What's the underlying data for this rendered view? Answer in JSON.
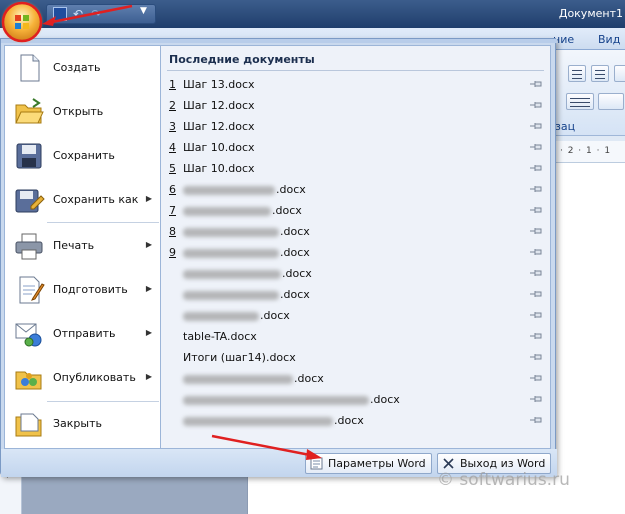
{
  "window": {
    "doc_title": "Документ1",
    "ribbon_tabs": [
      "ние",
      "Вид"
    ],
    "group_label": "зац"
  },
  "menu": {
    "commands": [
      {
        "label": "Создать",
        "icon": "new-document-icon",
        "submenu": false
      },
      {
        "label": "Открыть",
        "icon": "open-folder-icon",
        "submenu": false
      },
      {
        "label": "Сохранить",
        "icon": "save-disk-icon",
        "submenu": false
      },
      {
        "label": "Сохранить как",
        "icon": "save-as-icon",
        "submenu": true
      },
      {
        "label": "Печать",
        "icon": "printer-icon",
        "submenu": true
      },
      {
        "label": "Подготовить",
        "icon": "prepare-icon",
        "submenu": true
      },
      {
        "label": "Отправить",
        "icon": "send-icon",
        "submenu": true
      },
      {
        "label": "Опубликовать",
        "icon": "publish-icon",
        "submenu": true
      },
      {
        "label": "Закрыть",
        "icon": "close-folder-icon",
        "submenu": false
      }
    ],
    "recent_title": "Последние документы",
    "recent": [
      {
        "num": "1",
        "name": "Шаг 13.docx"
      },
      {
        "num": "2",
        "name": "Шаг 12.docx"
      },
      {
        "num": "3",
        "name": "Шаг 12.docx"
      },
      {
        "num": "4",
        "name": "Шаг 10.docx"
      },
      {
        "num": "5",
        "name": "Шаг 10.docx"
      },
      {
        "num": "6",
        "name": ".docx"
      },
      {
        "num": "7",
        "name": ".docx"
      },
      {
        "num": "8",
        "name": ".docx"
      },
      {
        "num": "9",
        "name": ".docx"
      },
      {
        "num": "",
        "name": ".docx"
      },
      {
        "num": "",
        "name": ".docx"
      },
      {
        "num": "",
        "name": ".docx"
      },
      {
        "num": "",
        "name": "table-TA.docx"
      },
      {
        "num": "",
        "name": "Итоги (шаг14).docx"
      },
      {
        "num": "",
        "name": ".docx"
      },
      {
        "num": "",
        "name": ".docx"
      },
      {
        "num": "",
        "name": ".docx"
      }
    ],
    "options_button": "Параметры Word",
    "exit_button": "Выход из Word"
  },
  "watermark": "© softwarius.ru",
  "colors": {
    "annotation_arrow": "#e02020",
    "title_bar": "#2a4a7a"
  }
}
